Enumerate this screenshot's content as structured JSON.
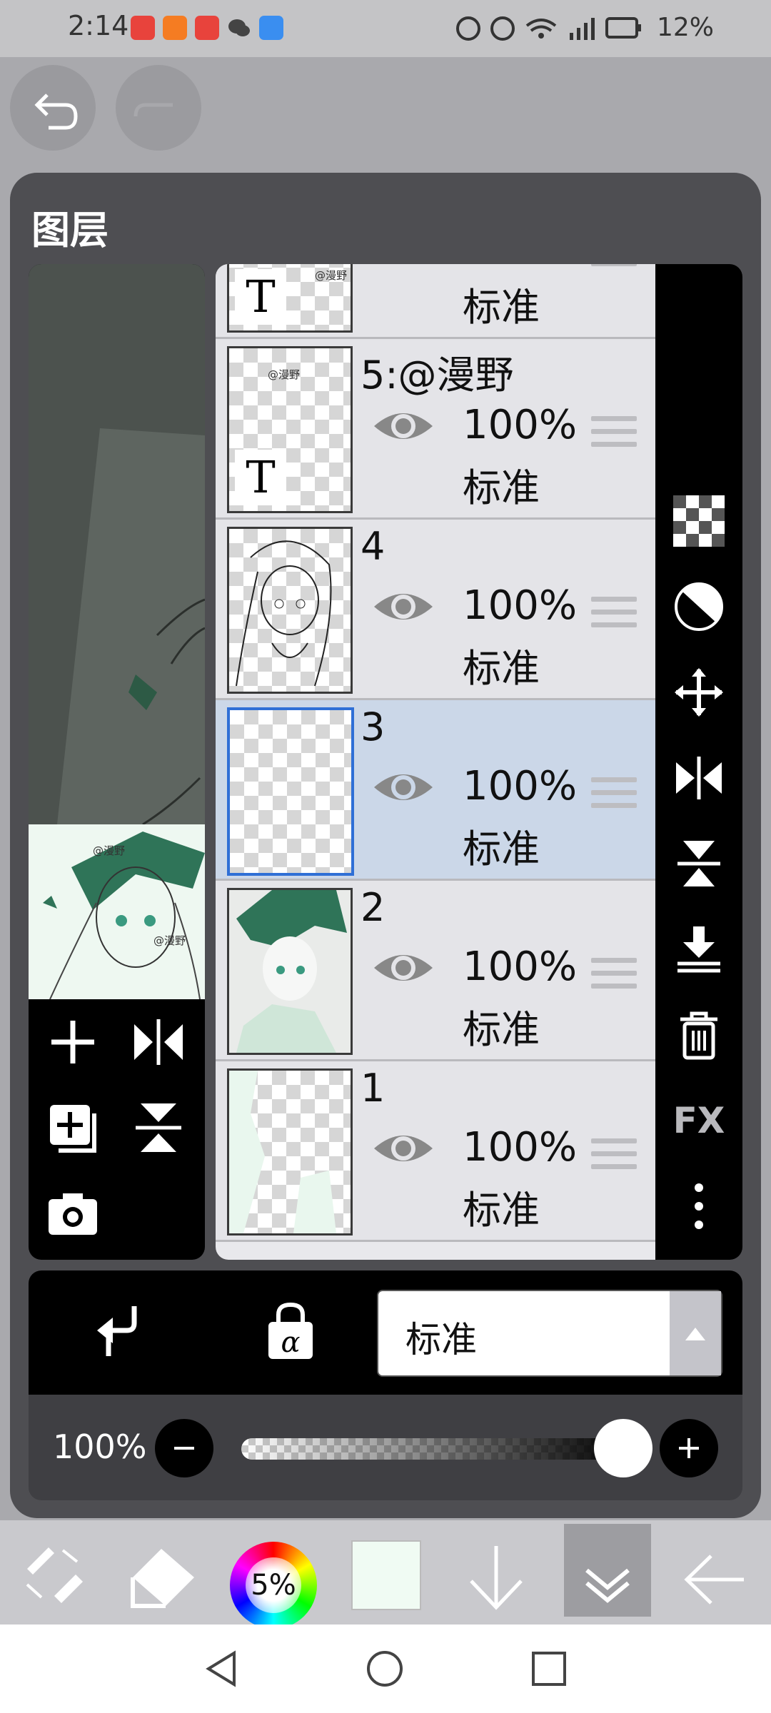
{
  "status_bar": {
    "time": "2:14",
    "battery": "12%",
    "app_icons": [
      "huawei-appgallery-icon",
      "video-app-icon",
      "huawei-appgallery-icon",
      "wechat-icon",
      "cloud-icon"
    ]
  },
  "top_buttons": {
    "undo": "undo-icon",
    "redo": "redo-icon"
  },
  "panel": {
    "title": "图层"
  },
  "layers": [
    {
      "name": "",
      "opacity": "",
      "blend": "标准",
      "type": "text",
      "watermark": "@漫野"
    },
    {
      "name": "5:@漫野",
      "opacity": "100%",
      "blend": "标准",
      "type": "text",
      "watermark": "@漫野"
    },
    {
      "name": "4",
      "opacity": "100%",
      "blend": "标准",
      "type": "raster"
    },
    {
      "name": "3",
      "opacity": "100%",
      "blend": "标准",
      "type": "raster",
      "selected": true
    },
    {
      "name": "2",
      "opacity": "100%",
      "blend": "标准",
      "type": "raster"
    },
    {
      "name": "1",
      "opacity": "100%",
      "blend": "标准",
      "type": "raster"
    }
  ],
  "preview": {
    "watermark1": "@漫野",
    "watermark2": "@漫野"
  },
  "left_tools": [
    "add-layer-icon",
    "flip-horizontal-icon",
    "add-copy-layer-icon",
    "flip-vertical-icon",
    "camera-icon"
  ],
  "right_tools": [
    "transparency-icon",
    "invert-icon",
    "move-icon",
    "flip-horizontal-icon",
    "flip-vertical-icon",
    "merge-down-icon",
    "trash-icon",
    "fx",
    "more-icon"
  ],
  "right_fx_label": "FX",
  "blend_bar": {
    "clip": "clip-icon",
    "alpha_lock": "alpha-lock-icon",
    "mode": "标准"
  },
  "opacity_bar": {
    "label": "100%",
    "value_pct": 100
  },
  "toolbar": {
    "color_percent": "5%",
    "swatch_color": "#f0fbf3",
    "tools": [
      "tool-switch-icon",
      "eraser-icon",
      "color-wheel",
      "color-swatch",
      "arrow-down-icon",
      "layers-collapse-icon",
      "back-arrow-icon"
    ]
  },
  "nav_bar": [
    "back-icon",
    "home-icon",
    "recents-icon"
  ]
}
